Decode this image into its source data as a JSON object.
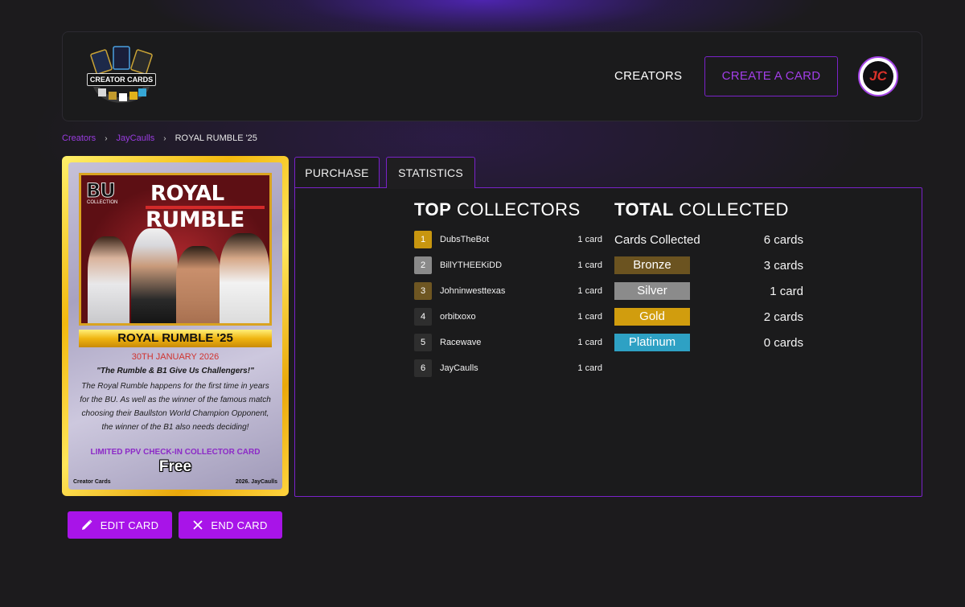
{
  "header": {
    "logo_text": "CREATOR CARDS",
    "nav_creators": "CREATORS",
    "create_button": "CREATE A CARD",
    "avatar_initials": "JC"
  },
  "breadcrumb": {
    "items": [
      "Creators",
      "JayCaulls"
    ],
    "current": "ROYAL RUMBLE '25"
  },
  "card": {
    "art_logo": "BU",
    "art_logo_sub": "COLLECTION",
    "art_title_line1": "ROYAL",
    "art_title_line2": "RUMBLE",
    "title": "ROYAL RUMBLE '25",
    "date": "30TH JANUARY 2026",
    "quote": "\"The Rumble & B1 Give Us Challengers!\"",
    "description": "The Royal Rumble happens for the first time in years for the BU. As well as the winner of the famous match choosing their Baullston World Champion Opponent, the winner of the B1 also needs deciding!",
    "limited": "LIMITED PPV CHECK-IN COLLECTOR CARD",
    "price": "Free",
    "footer_left": "Creator Cards",
    "footer_right": "2026. JayCaulls"
  },
  "actions": {
    "edit_label": "EDIT CARD",
    "end_label": "END CARD"
  },
  "tabs": [
    {
      "label": "PURCHASE",
      "active": false
    },
    {
      "label": "STATISTICS",
      "active": true
    }
  ],
  "top_collectors": {
    "title_bold": "TOP",
    "title_rest": " COLLECTORS",
    "rows": [
      {
        "rank": "1",
        "name": "DubsTheBot",
        "count": "1 card",
        "color": "#c8960f"
      },
      {
        "rank": "2",
        "name": "BillYTHEEKiDD",
        "count": "1 card",
        "color": "#8a8a8a"
      },
      {
        "rank": "3",
        "name": "Johninwesttexas",
        "count": "1 card",
        "color": "#6e5622"
      },
      {
        "rank": "4",
        "name": "orbitxoxo",
        "count": "1 card",
        "color": "#2e2e2e"
      },
      {
        "rank": "5",
        "name": "Racewave",
        "count": "1 card",
        "color": "#2e2e2e"
      },
      {
        "rank": "6",
        "name": "JayCaulls",
        "count": "1 card",
        "color": "#2e2e2e"
      }
    ]
  },
  "total_collected": {
    "title_bold": "TOTAL",
    "title_rest": " COLLECTED",
    "cards_collected_label": "Cards Collected",
    "cards_collected_value": "6 cards",
    "tiers": [
      {
        "name": "Bronze",
        "value": "3 cards",
        "color": "#6b5320"
      },
      {
        "name": "Silver",
        "value": "1 card",
        "color": "#8b8b8b"
      },
      {
        "name": "Gold",
        "value": "2 cards",
        "color": "#d19d0e"
      },
      {
        "name": "Platinum",
        "value": "0 cards",
        "color": "#2ea1c4"
      }
    ]
  }
}
